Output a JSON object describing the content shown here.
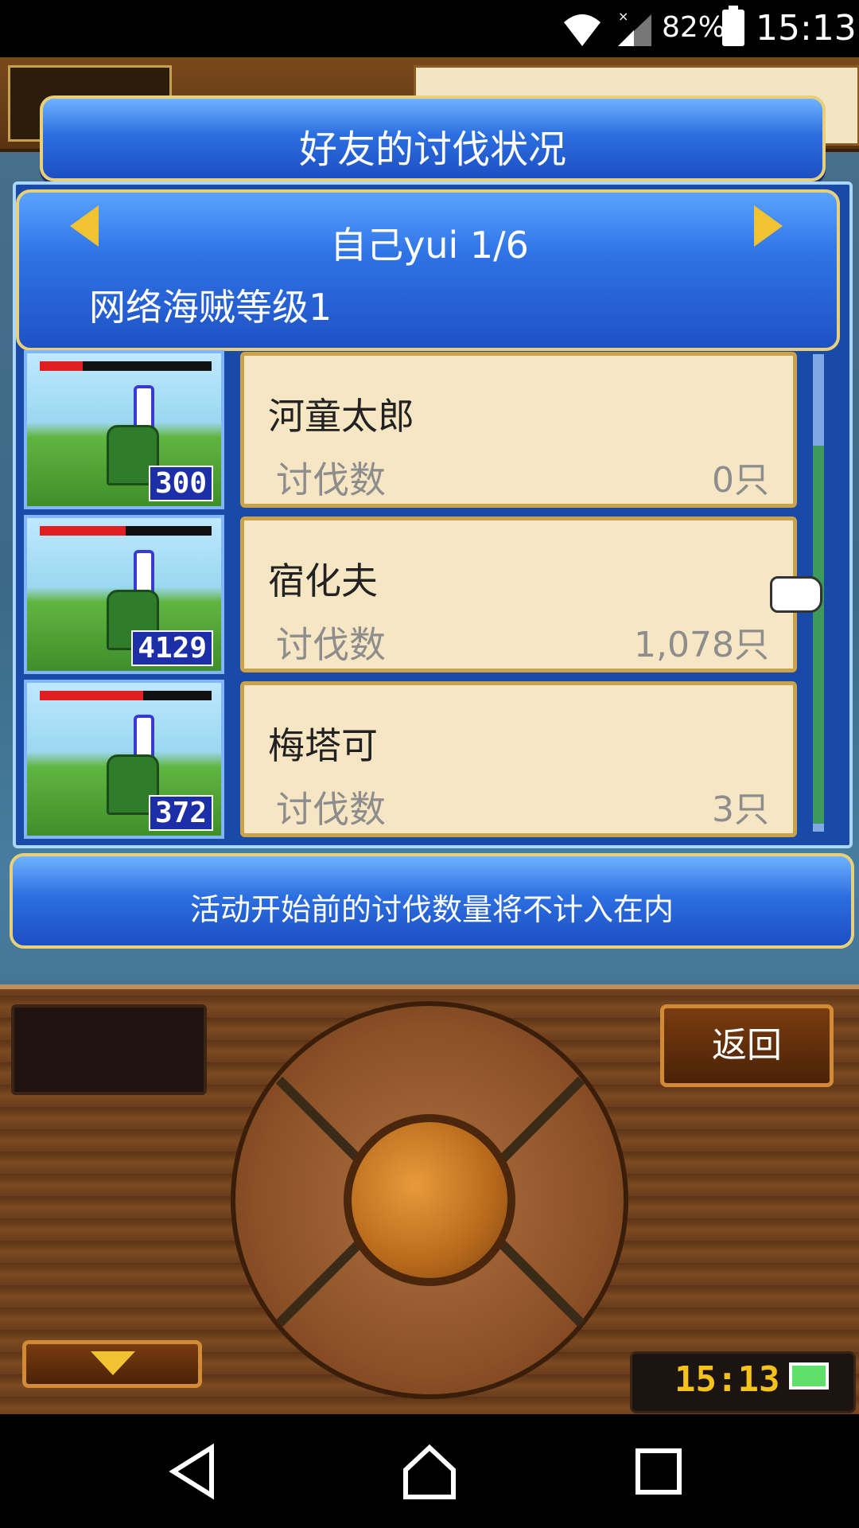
{
  "status_bar": {
    "battery": "82%",
    "time": "15:13"
  },
  "header": {
    "title": "好友的讨伐状况"
  },
  "friend_selector": {
    "name": "自己yui 1/6",
    "rank": "网络海贼等级1"
  },
  "list": [
    {
      "name": "河童太郎",
      "label": "讨伐数",
      "count": "0只",
      "thumb_number": "300",
      "hp_fraction": 0.25
    },
    {
      "name": "宿化夫",
      "label": "讨伐数",
      "count": "1,078只",
      "thumb_number": "4129",
      "hp_fraction": 0.5
    },
    {
      "name": "梅塔可",
      "label": "讨伐数",
      "count": "3只",
      "thumb_number": "372",
      "hp_fraction": 0.6
    }
  ],
  "footer_note": "活动开始前的讨伐数量将不计入在内",
  "controls": {
    "back_label": "返回",
    "clock": "15:13"
  },
  "icons": [
    "wifi-icon",
    "signal-icon",
    "battery-icon",
    "arrow-left-icon",
    "arrow-right-icon",
    "pointer-hand-icon",
    "dpad-icon",
    "down-arrow-icon",
    "nav-back-icon",
    "nav-home-icon",
    "nav-recents-icon"
  ],
  "colors": {
    "panel_blue": "#2c6fe0",
    "card_bg": "#f6e6c3",
    "gold": "#e8d07a",
    "wood": "#7b4a22"
  }
}
